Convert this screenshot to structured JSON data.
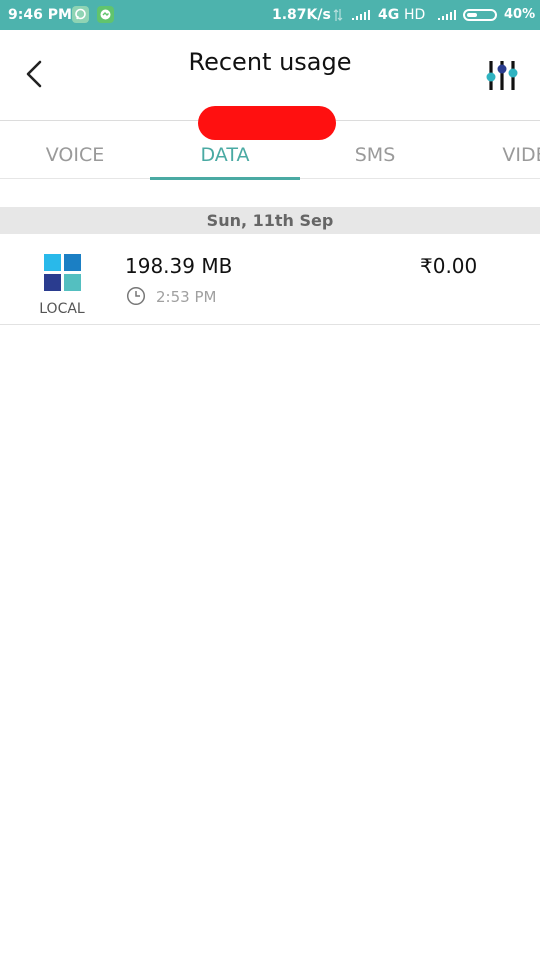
{
  "status_bar": {
    "time": "9:46 PM",
    "speed": "1.87K/s",
    "network": "4G",
    "hd": "HD",
    "battery_percent": "40%",
    "battery_level": 0.4,
    "notification_icons": [
      "chat-icon",
      "messenger-icon"
    ]
  },
  "header": {
    "title": "Recent usage",
    "back_icon": "chevron-left-icon",
    "filter_icon": "sliders-icon"
  },
  "tabs": [
    {
      "label": "VOICE",
      "active": false
    },
    {
      "label": "DATA",
      "active": true
    },
    {
      "label": "SMS",
      "active": false
    },
    {
      "label": "VIDE",
      "active": false
    }
  ],
  "date_header": "Sun, 11th Sep",
  "usage": [
    {
      "type_label": "LOCAL",
      "amount": "198.39 MB",
      "time": "2:53 PM",
      "cost": "₹0.00"
    }
  ],
  "colors": {
    "status_bar": "#4db3ad",
    "accent": "#4aaaa3",
    "redaction": "#ff1010",
    "tile_1": "#29b9ea",
    "tile_2": "#1b7fc4",
    "tile_3": "#2a3c8f",
    "tile_4": "#54bfc0"
  }
}
